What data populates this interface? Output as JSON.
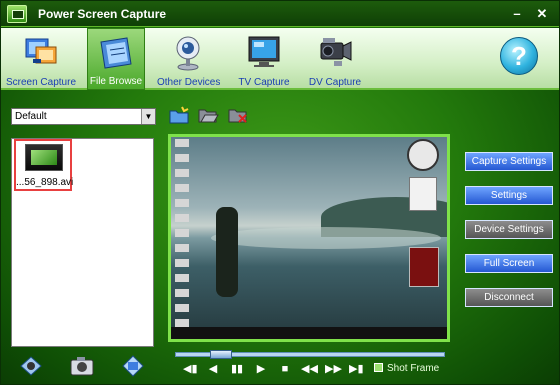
{
  "window": {
    "title": "Power Screen Capture",
    "minimize": "–",
    "close": "✕"
  },
  "toolbar": {
    "items": [
      {
        "label": "Screen Capture",
        "icon": "screen-capture-icon"
      },
      {
        "label": "File Browse",
        "icon": "file-browse-icon",
        "active": true
      },
      {
        "label": "Other Devices",
        "icon": "webcam-icon"
      },
      {
        "label": "TV Capture",
        "icon": "tv-icon"
      },
      {
        "label": "DV Capture",
        "icon": "camcorder-icon"
      }
    ],
    "help": "?"
  },
  "folder": {
    "selected": "Default",
    "arrow": "▼"
  },
  "files": [
    {
      "name": "...56_898.avi"
    }
  ],
  "side_buttons": {
    "capture_settings": "Capture Settings",
    "settings": "Settings",
    "device_settings": "Device Settings",
    "full_screen": "Full Screen",
    "disconnect": "Disconnect"
  },
  "playback": {
    "controls": [
      "◀▮",
      "◀",
      "▮▮",
      "▶",
      "■",
      "◀◀",
      "▶▶",
      "▶▮",
      "◀)"
    ],
    "shot_frame": "Shot Frame",
    "position": 0.14
  },
  "colors": {
    "accent": "#7fe24a",
    "button_blue": "#2558d2",
    "selection_red": "#e84040"
  }
}
